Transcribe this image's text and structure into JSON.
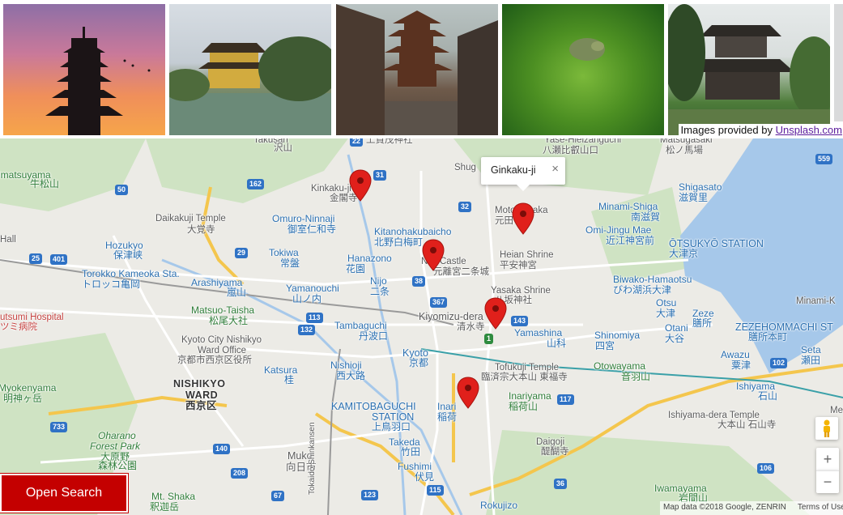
{
  "gallery": {
    "photos": [
      {
        "icon": "pagoda-sunset-photo"
      },
      {
        "icon": "golden-pavilion-photo"
      },
      {
        "icon": "street-pagoda-photo"
      },
      {
        "icon": "moss-garden-photo"
      },
      {
        "icon": "silver-pavilion-photo"
      }
    ],
    "credit_prefix": "Images provided by ",
    "credit_link": "Unsplash.com"
  },
  "map": {
    "info_window": {
      "title": "Ginkaku-ji",
      "close": "×"
    },
    "labels": {
      "yase": "Yase-Hieizanguchi",
      "yase_jp": "八瀬比叡山口",
      "matsugasaki": "Matsugasaki",
      "matsugasaki_jp": "松ノ馬場",
      "takusan": "Takusan",
      "takusan_jp": "沢山",
      "jouju": "上賀茂神社",
      "shug": "Shug",
      "matsuyama": "imatsuyama",
      "matsuyama_jp": "牛松山",
      "kinkaku": "Kinkaku-ji",
      "kinkaku_jp": "金閣寺",
      "daikakuji": "Daikakuji Temple",
      "daikakuji_jp": "大覚寺",
      "omuro": "Omuro-Ninnaji",
      "omuro_jp": "御室仁和寺",
      "kitano": "Kitanohakubaicho",
      "kitano_jp": "北野白梅町",
      "moto": "Moto",
      "aka": "aka",
      "moto_jp": "元田",
      "minamishiga": "Minami-Shiga",
      "minamishiga_jp": "南滋賀",
      "shigasato": "Shigasato",
      "shigasato_jp": "滋賀里",
      "omijingu": "Omi-Jingu Mae",
      "omijingu_jp": "近江神宮前",
      "otsukyo": "ŌTSUKYŌ STATION",
      "otsukyo_jp": "大津京",
      "hall": "Hall",
      "hozukyo": "Hozukyo",
      "hozukyo_jp": "保津峡",
      "torokko": "Torokko Kameoka Sta.",
      "torokko_jp": "トロッコ亀岡",
      "tokiwa": "Tokiwa",
      "tokiwa_jp": "常盤",
      "hanazono": "Hanazono",
      "hanazono_jp": "花園",
      "nijocastle": "Nijo Castle",
      "nijocastle_jp": "元離宮二条城",
      "heian": "Heian Shrine",
      "heian_jp": "平安神宮",
      "arashiyama": "Arashiyama",
      "arashiyama_jp": "嵐山",
      "yamanouchi": "Yamanouchi",
      "yamanouchi_jp": "山ノ内",
      "nijo": "Nijo",
      "nijo_jp": "二条",
      "yasaka": "Yasaka Shrine",
      "yasaka_jp": "八坂神社",
      "biwako": "Biwako-Hamaotsu",
      "biwako_jp": "びわ湖浜大津",
      "hospital": "utsumi Hospital",
      "hospital_jp": "ツミ病院",
      "matsuo": "Matsuo-Taisha",
      "matsuo_jp": "松尾大社",
      "kiyomizu": "Kiyomizu-dera",
      "kiyomizu_jp": "清水寺",
      "otsu": "Otsu",
      "otsu_jp": "大津",
      "zeze": "Zeze",
      "zeze_jp": "膳所",
      "zezehommachi": "ZEZEHOMMACHI ST",
      "zezehommachi_jp": "膳所本町",
      "minamikusatsu": "Minami-K",
      "nishikyoward": "Kyoto City Nishikyo",
      "wardoffice": "Ward Office",
      "wardoffice_jp": "京都市西京区役所",
      "tambaguchi": "Tambaguchi",
      "tambaguchi_jp": "丹波口",
      "yamashina": "Yamashina",
      "yamashina_jp": "山科",
      "shinomiya": "Shinomiya",
      "shinomiya_jp": "四宮",
      "otani": "Otani",
      "otani_jp": "大谷",
      "kyoto": "Kyoto",
      "kyoto_jp": "京都",
      "nishioji": "Nishioji",
      "nishioji_jp": "西大路",
      "tofukuji": "Tofukuji Temple",
      "tofukuji_jp": "臨済宗大本山 東福寺",
      "otowayama": "Otowayama",
      "otowayama_jp": "音羽山",
      "awazu": "Awazu",
      "awazu_jp": "粟津",
      "seta": "Seta",
      "seta_jp": "瀬田",
      "katsura": "Katsura",
      "katsura_jp": "桂",
      "nishikyo": "NISHIKYO",
      "ward": "WARD",
      "nishikyo_jp": "西京区",
      "ishiyama": "Ishiyama",
      "ishiyama_jp": "石山",
      "inariyama": "Inariyama",
      "inariyama_jp": "稲荷山",
      "kamitobaguchi": "KAMITOBAGUCHI",
      "station": "STATION",
      "kamitobaguchi_jp": "上鳥羽口",
      "inari": "Inari",
      "inari_jp": "稲荷",
      "ishiyamadera": "Ishiyama-dera Temple",
      "ishiyamadera_jp": "大本山 石山寺",
      "myokenyama": "Myokenyama",
      "myokenyama_jp": "明神ヶ岳",
      "oharano": "Oharano",
      "forestpark": "Forest Park",
      "forestpark_jp": "大原野",
      "forestpark_jp2": "森林公園",
      "takeda": "Takeda",
      "takeda_jp": "竹田",
      "daigoji": "Daigoji",
      "daigoji_jp": "醍醐寺",
      "muko": "Muko",
      "muko_jp": "向日市",
      "fushimi": "Fushimi",
      "fushimi_jp": "伏見",
      "shinkansen": "Tokaido Shinkansen",
      "iwamayama": "Iwamayama",
      "iwamayama_jp": "岩間山",
      "mtshaka": "Mt. Shaka",
      "mtshaka_jp": "釈迦岳",
      "rokujizo": "Rokujizo",
      "me": "Me"
    },
    "shields": [
      "31",
      "50",
      "162",
      "559",
      "25",
      "401",
      "29",
      "32",
      "38",
      "367",
      "113",
      "132",
      "143",
      "1",
      "117",
      "102",
      "733",
      "140",
      "208",
      "67",
      "123",
      "115",
      "36",
      "106",
      "22"
    ],
    "attribution": {
      "mapdata": "Map data ©2018 Google, ZENRIN",
      "terms": "Terms of Use"
    },
    "controls": {
      "zoom_in": "+",
      "zoom_out": "−"
    }
  },
  "open_search": "Open Search"
}
